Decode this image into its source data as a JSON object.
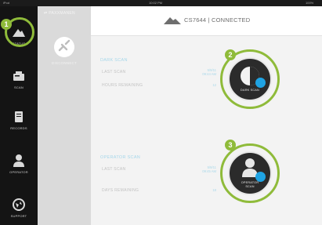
{
  "statusbar": {
    "carrier": "iPod",
    "time": "10:02 PM",
    "battery": "100%"
  },
  "nav": {
    "items": [
      {
        "label": "STATUS",
        "icon": "status-icon"
      },
      {
        "label": "SCAN",
        "icon": "scan-icon"
      },
      {
        "label": "RECORDS",
        "icon": "records-icon"
      },
      {
        "label": "OPERATOR",
        "icon": "operator-icon"
      },
      {
        "label": "SUPPORT",
        "icon": "support-icon"
      }
    ]
  },
  "panel": {
    "title": "PAXXMANEN",
    "disconnect_label": "DISCONNECT"
  },
  "header": {
    "device_title": "CS7644 | CONNECTED"
  },
  "dark_scan": {
    "title": "DARK SCAN",
    "last_scan_label": "LAST SCAN",
    "last_scan_value_line1": "5/9/11",
    "last_scan_value_line2": "09:44 AM",
    "hours_label": "HOURS REMAINING",
    "hours_value": "12",
    "button_label": "DARK SCAN"
  },
  "operator_scan": {
    "title": "OPERATOR SCAN",
    "last_scan_label": "LAST SCAN",
    "last_scan_value_line1": "5/9/11",
    "last_scan_value_line2": "09:45 AM",
    "days_label": "DAYS REMAINING",
    "days_value": "18",
    "button_label_line1": "OPERATOR",
    "button_label_line2": "SCAN"
  },
  "callouts": [
    "1",
    "2",
    "3"
  ],
  "colors": {
    "accent_green": "#8fbb3a",
    "accent_blue": "#1fa3e3",
    "nav_bg": "#141414"
  }
}
